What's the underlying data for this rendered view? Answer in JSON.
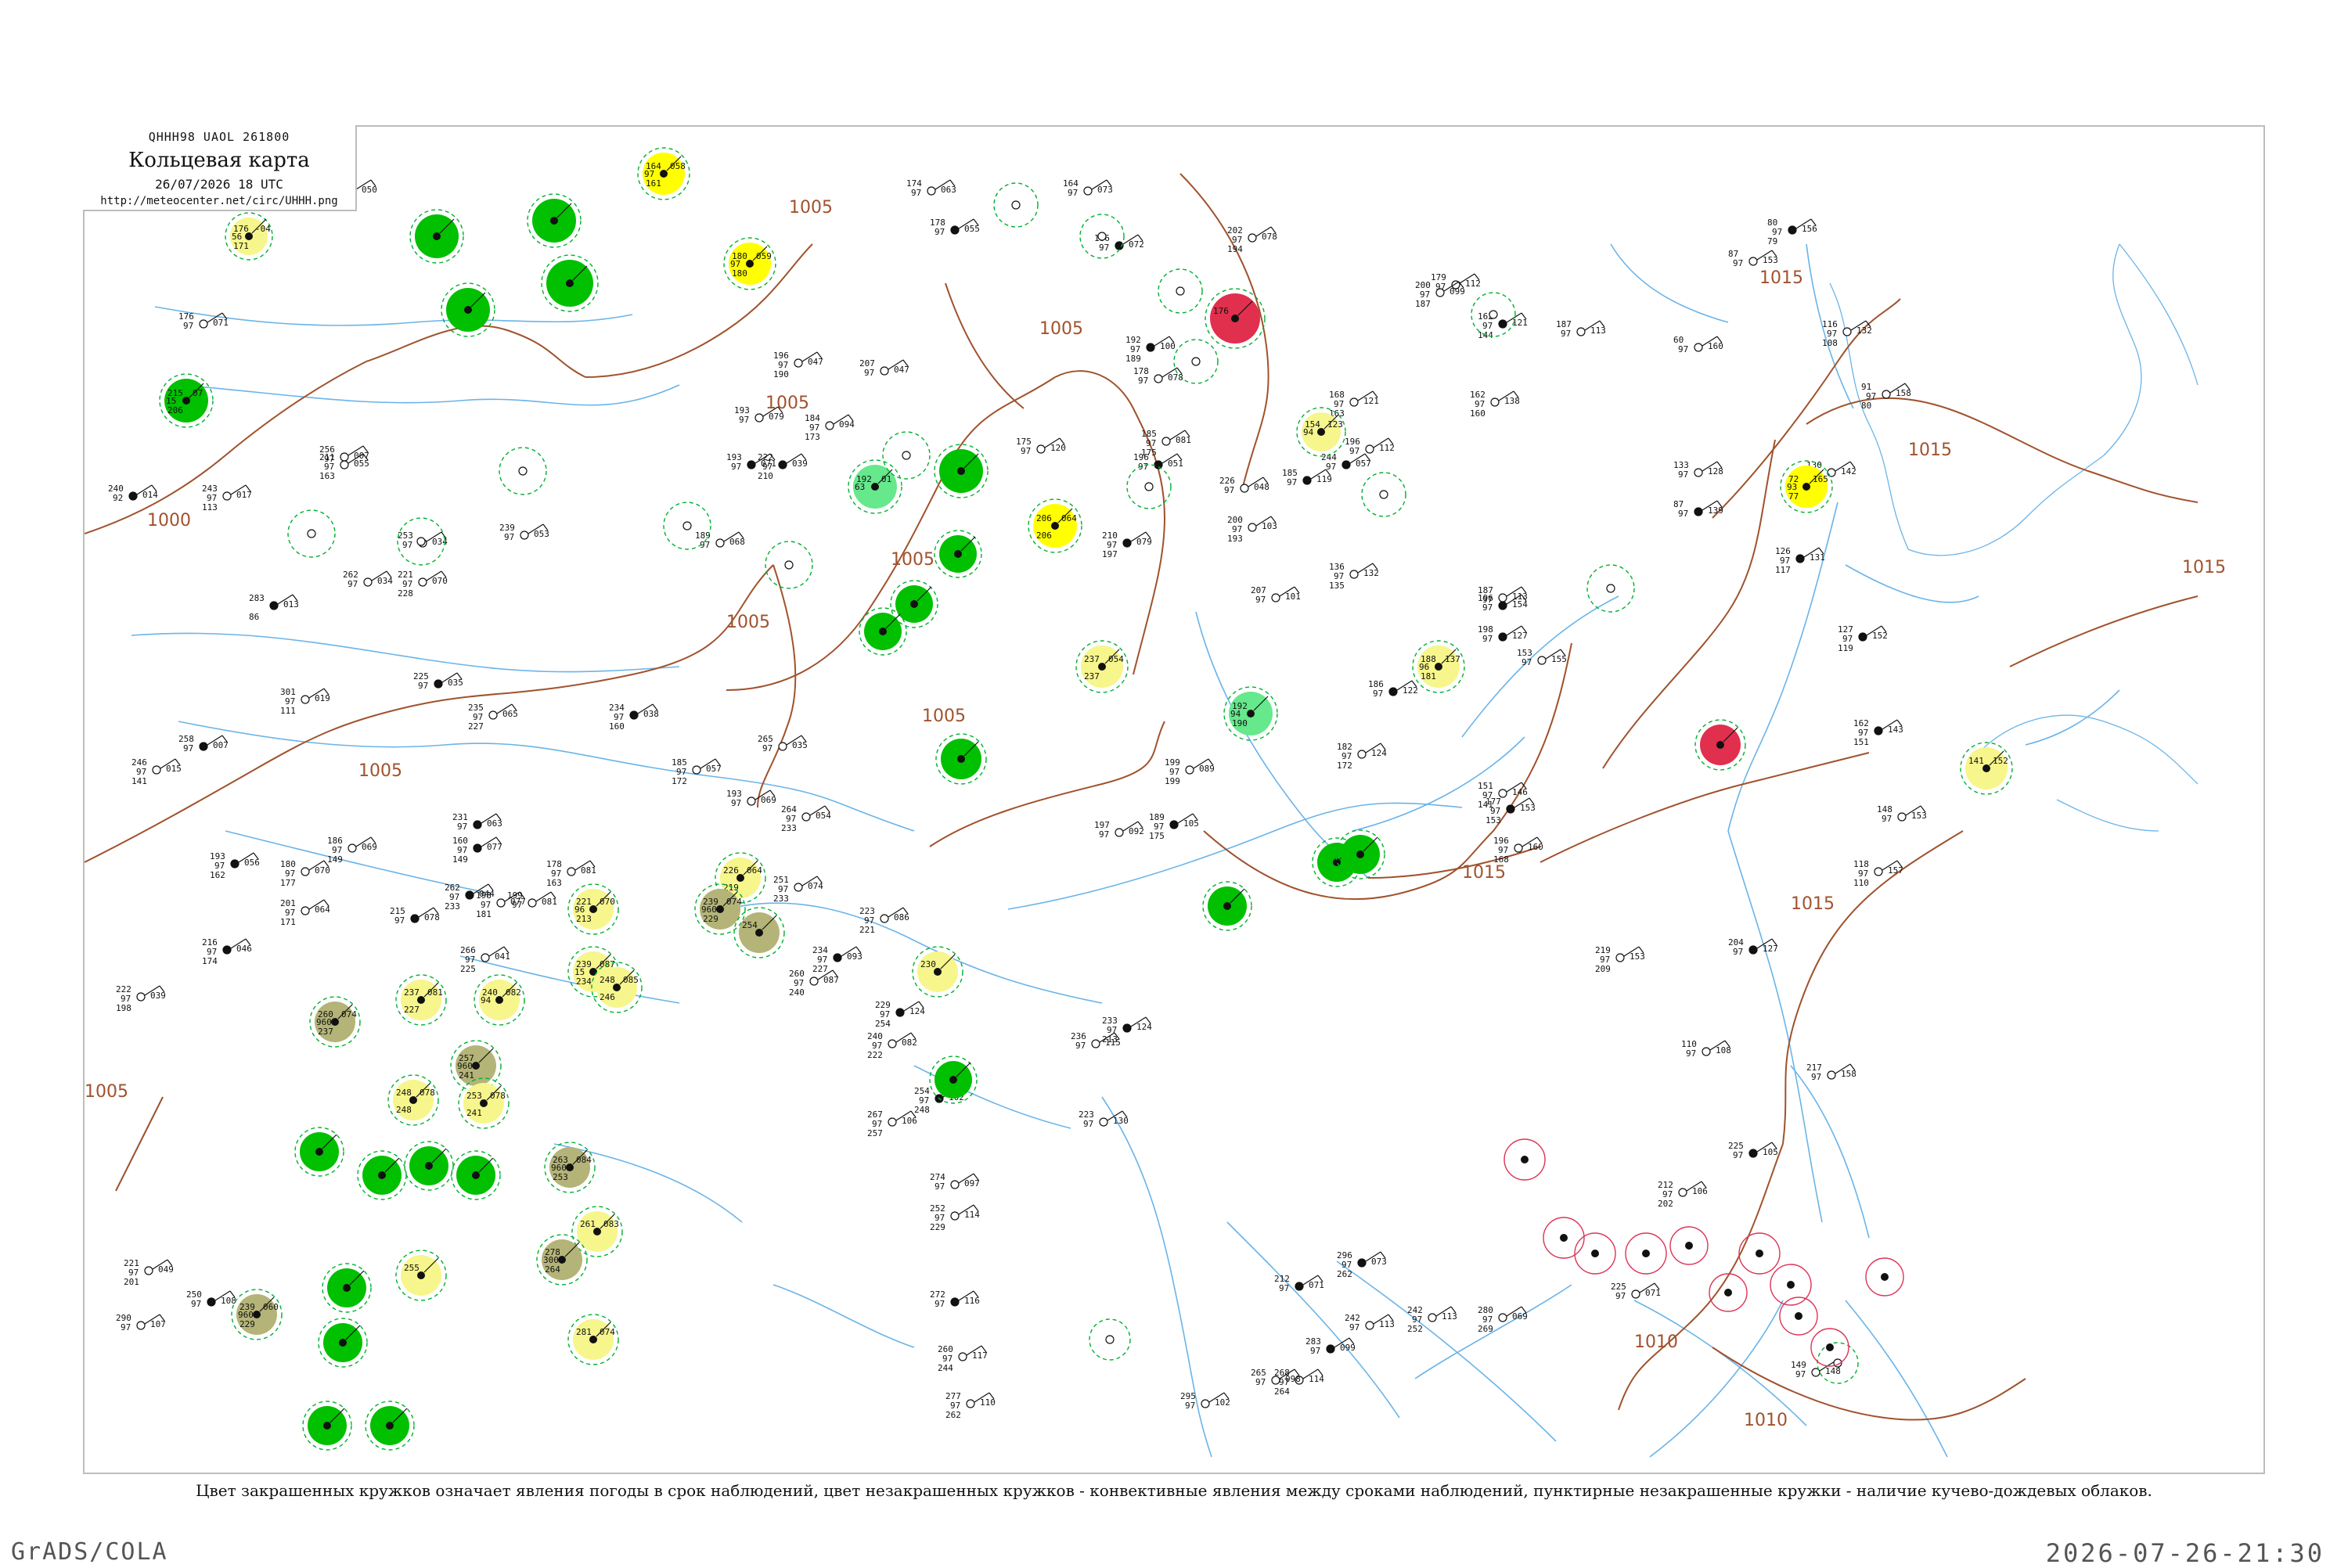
{
  "header": {
    "code_line": "QHHH98  UAOL  261800",
    "title": "Кольцевая карта",
    "datetime": "26/07/2026 18 UTC",
    "url": "http://meteocenter.net/circ/UHHH.png"
  },
  "isobars": {
    "labels": [
      "1000",
      "1005",
      "1010",
      "1015"
    ]
  },
  "legend": {
    "colors": {
      "fair": "#00c000",
      "rain_light": "#66e88c",
      "haze": "#ffff00",
      "haze_light": "#f6f68c",
      "dust": "#b4b478",
      "thunder": "#e0304e",
      "isobar": "#a0522d",
      "rivers": "#6ab4e8",
      "cb_dashed": "#00b030",
      "convective": "#dd3355"
    }
  },
  "stations": [
    {
      "code": "56",
      "temp": "176",
      "dew": "171",
      "pres": "-04",
      "color_key": "haze_light"
    },
    {
      "code": "15",
      "temp": "215",
      "dew": "206",
      "pres": "07",
      "color_key": "fair"
    },
    {
      "code": "97",
      "temp": "164",
      "dew": "161",
      "pres": "058",
      "color_key": "haze"
    },
    {
      "code": "97",
      "temp": "180",
      "dew": "180",
      "pres": "059",
      "color_key": "haze"
    },
    {
      "code": "",
      "temp": "176",
      "dew": "",
      "pres": "",
      "color_key": "thunder"
    },
    {
      "code": "63",
      "temp": "192",
      "dew": "",
      "pres": "01",
      "color_key": "rain_light"
    },
    {
      "code": "",
      "temp": "206",
      "dew": "206",
      "pres": "064",
      "color_key": "haze"
    },
    {
      "code": "",
      "temp": "237",
      "dew": "237",
      "pres": "054",
      "color_key": "haze_light"
    },
    {
      "code": "94",
      "temp": "192",
      "dew": "190",
      "pres": "",
      "color_key": "rain_light"
    },
    {
      "code": "96",
      "temp": "188",
      "dew": "181",
      "pres": "137",
      "color_key": "haze_light"
    },
    {
      "code": "94",
      "temp": "154",
      "dew": "",
      "pres": "123",
      "color_key": "haze_light"
    },
    {
      "code": "93",
      "temp": "72",
      "dew": "77",
      "pres": "165",
      "color_key": "haze"
    },
    {
      "code": "",
      "temp": "141",
      "dew": "",
      "pres": "152",
      "color_key": "haze_light"
    },
    {
      "code": "",
      "temp": "226",
      "dew": "219",
      "pres": "064",
      "color_key": "haze_light"
    },
    {
      "code": "9600",
      "temp": "239",
      "dew": "229",
      "pres": "074",
      "color_key": "dust"
    },
    {
      "code": "",
      "temp": "254",
      "dew": "",
      "pres": "",
      "color_key": "dust"
    },
    {
      "code": "96",
      "temp": "221",
      "dew": "213",
      "pres": "070",
      "color_key": "haze_light"
    },
    {
      "code": "15",
      "temp": "239",
      "dew": "234",
      "pres": "087",
      "color_key": "haze_light"
    },
    {
      "code": "",
      "temp": "237",
      "dew": "227",
      "pres": "081",
      "color_key": "haze_light"
    },
    {
      "code": "94",
      "temp": "240",
      "dew": "",
      "pres": "082",
      "color_key": "haze_light"
    },
    {
      "code": "",
      "temp": "248",
      "dew": "246",
      "pres": "085",
      "color_key": "haze_light"
    },
    {
      "code": "9600",
      "temp": "260",
      "dew": "237",
      "pres": "074",
      "color_key": "dust"
    },
    {
      "code": "9600",
      "temp": "257",
      "dew": "241",
      "pres": "",
      "color_key": "dust"
    },
    {
      "code": "",
      "temp": "248",
      "dew": "248",
      "pres": "078",
      "color_key": "haze_light"
    },
    {
      "code": "",
      "temp": "253",
      "dew": "241",
      "pres": "078",
      "color_key": "haze_light"
    },
    {
      "code": "",
      "temp": "230",
      "dew": "",
      "pres": "",
      "color_key": "haze_light"
    },
    {
      "code": "9600",
      "temp": "263",
      "dew": "253",
      "pres": "084",
      "color_key": "dust"
    },
    {
      "code": "",
      "temp": "261",
      "dew": "",
      "pres": "083",
      "color_key": "haze_light"
    },
    {
      "code": "3000",
      "temp": "278",
      "dew": "264",
      "pres": "",
      "color_key": "dust"
    },
    {
      "code": "",
      "temp": "281",
      "dew": "",
      "pres": "074",
      "color_key": "haze_light"
    },
    {
      "code": "",
      "temp": "255",
      "dew": "",
      "pres": "",
      "color_key": "haze_light"
    },
    {
      "code": "9600",
      "temp": "239",
      "dew": "229",
      "pres": "060",
      "color_key": "dust"
    },
    {
      "code": "",
      "temp": "",
      "dew": "",
      "pres": "",
      "color_key": "fair"
    },
    {
      "code": "",
      "temp": "",
      "dew": "",
      "pres": "",
      "color_key": "fair"
    },
    {
      "code": "",
      "temp": "",
      "dew": "",
      "pres": "",
      "color_key": "fair"
    },
    {
      "code": "",
      "temp": "",
      "dew": "",
      "pres": "",
      "color_key": "fair"
    },
    {
      "code": "",
      "temp": "",
      "dew": "",
      "pres": "",
      "color_key": "fair"
    },
    {
      "code": "",
      "temp": "",
      "dew": "",
      "pres": "",
      "color_key": "fair"
    },
    {
      "code": "",
      "temp": "",
      "dew": "",
      "pres": "",
      "color_key": "fair"
    },
    {
      "code": "",
      "temp": "",
      "dew": "",
      "pres": "",
      "color_key": "fair"
    },
    {
      "code": "",
      "temp": "",
      "dew": "",
      "pres": "",
      "color_key": "fair"
    },
    {
      "code": "",
      "temp": "",
      "dew": "",
      "pres": "",
      "color_key": "fair"
    },
    {
      "code": "",
      "temp": "",
      "dew": "",
      "pres": "",
      "color_key": "fair"
    },
    {
      "code": "",
      "temp": "",
      "dew": "",
      "pres": "",
      "color_key": "fair"
    },
    {
      "code": "",
      "temp": "",
      "dew": "",
      "pres": "",
      "color_key": "fair"
    },
    {
      "code": "",
      "temp": "",
      "dew": "",
      "pres": "",
      "color_key": "fair"
    },
    {
      "code": "",
      "temp": "",
      "dew": "",
      "pres": "",
      "color_key": "fair"
    },
    {
      "code": "",
      "temp": "",
      "dew": "",
      "pres": "",
      "color_key": "fair"
    },
    {
      "code": "",
      "temp": "",
      "dew": "",
      "pres": "",
      "color_key": "fair"
    },
    {
      "code": "",
      "temp": "",
      "dew": "",
      "pres": "",
      "color_key": "fair"
    },
    {
      "code": "",
      "temp": "",
      "dew": "",
      "pres": "",
      "color_key": "fair"
    },
    {
      "code": "",
      "temp": "",
      "dew": "",
      "pres": "",
      "color_key": "fair"
    },
    {
      "code": "",
      "temp": "",
      "dew": "",
      "pres": "",
      "color_key": "fair"
    },
    {
      "code": "",
      "temp": "",
      "dew": "",
      "pres": "",
      "color_key": "thunder"
    }
  ],
  "plain_stations": [
    [
      "192",
      "97",
      "163",
      "050"
    ],
    [
      "168",
      "97",
      "163",
      "052"
    ],
    [
      "176",
      "97",
      "",
      "071"
    ],
    [
      "240",
      "92",
      "",
      "014"
    ],
    [
      "243",
      "97",
      "113",
      "017"
    ],
    [
      "256",
      "97",
      "",
      "007"
    ],
    [
      "283",
      "",
      "86",
      "013"
    ],
    [
      "262",
      "97",
      "",
      "034"
    ],
    [
      "253",
      "97",
      "",
      "034"
    ],
    [
      "225",
      "97",
      "",
      "035"
    ],
    [
      "211",
      "97",
      "163",
      "055"
    ],
    [
      "239",
      "97",
      "",
      "053"
    ],
    [
      "222",
      "97",
      "210",
      "039"
    ],
    [
      "189",
      "97",
      "",
      "068"
    ],
    [
      "265",
      "97",
      "",
      "035"
    ],
    [
      "234",
      "97",
      "160",
      "038"
    ],
    [
      "185",
      "97",
      "172",
      "057"
    ],
    [
      "193",
      "97",
      "",
      "069"
    ],
    [
      "216",
      "97",
      "174",
      "046"
    ],
    [
      "222",
      "97",
      "198",
      "039"
    ],
    [
      "246",
      "97",
      "141",
      "015"
    ],
    [
      "258",
      "97",
      "",
      "007"
    ],
    [
      "301",
      "97",
      "111",
      "019"
    ],
    [
      "186",
      "97",
      "149",
      "069"
    ],
    [
      "193",
      "97",
      "162",
      "056"
    ],
    [
      "180",
      "97",
      "177",
      "070"
    ],
    [
      "201",
      "97",
      "171",
      "064"
    ],
    [
      "215",
      "97",
      "",
      "078"
    ],
    [
      "178",
      "97",
      "163",
      "081"
    ],
    [
      "198",
      "97",
      "181",
      "077"
    ],
    [
      "160",
      "97",
      "149",
      "077"
    ],
    [
      "264",
      "97",
      "233",
      "054"
    ],
    [
      "251",
      "97",
      "233",
      "074"
    ],
    [
      "234",
      "97",
      "227",
      "093"
    ],
    [
      "223",
      "97",
      "221",
      "086"
    ],
    [
      "260",
      "97",
      "240",
      "087"
    ],
    [
      "229",
      "97",
      "254",
      "124"
    ],
    [
      "240",
      "97",
      "222",
      "082"
    ],
    [
      "267",
      "97",
      "257",
      "106"
    ],
    [
      "254",
      "97",
      "248",
      "102"
    ],
    [
      "274",
      "97",
      "",
      "097"
    ],
    [
      "252",
      "97",
      "229",
      "114"
    ],
    [
      "272",
      "97",
      "",
      "116"
    ],
    [
      "260",
      "97",
      "244",
      "117"
    ],
    [
      "277",
      "97",
      "262",
      "110"
    ],
    [
      "233",
      "97",
      "213",
      "124"
    ],
    [
      "223",
      "97",
      "",
      "130"
    ],
    [
      "236",
      "97",
      "",
      "115"
    ],
    [
      "210",
      "97",
      "197",
      "079"
    ],
    [
      "199",
      "97",
      "199",
      "089"
    ],
    [
      "197",
      "97",
      "",
      "092"
    ],
    [
      "189",
      "97",
      "175",
      "105"
    ],
    [
      "200",
      "97",
      "193",
      "103"
    ],
    [
      "182",
      "97",
      "172",
      "124"
    ],
    [
      "186",
      "97",
      "",
      "122"
    ],
    [
      "196",
      "97",
      "",
      "112"
    ],
    [
      "207",
      "97",
      "",
      "101"
    ],
    [
      "185",
      "97",
      "",
      "119"
    ],
    [
      "168",
      "97",
      "163",
      "121"
    ],
    [
      "179",
      "97",
      "",
      "112"
    ],
    [
      "162",
      "97",
      "144",
      "121"
    ],
    [
      "162",
      "97",
      "160",
      "138"
    ],
    [
      "187",
      "97",
      "",
      "113"
    ],
    [
      "198",
      "97",
      "",
      "127"
    ],
    [
      "153",
      "97",
      "",
      "155"
    ],
    [
      "151",
      "97",
      "141",
      "146"
    ],
    [
      "177",
      "97",
      "153",
      "153"
    ],
    [
      "196",
      "97",
      "168",
      "160"
    ],
    [
      "219",
      "97",
      "209",
      "153"
    ],
    [
      "204",
      "97",
      "",
      "127"
    ],
    [
      "110",
      "97",
      "",
      "108"
    ],
    [
      "217",
      "97",
      "",
      "158"
    ],
    [
      "225",
      "97",
      "",
      "105"
    ],
    [
      "212",
      "97",
      "202",
      "106"
    ],
    [
      "149",
      "97",
      "",
      "148"
    ],
    [
      "162",
      "97",
      "151",
      "143"
    ],
    [
      "148",
      "97",
      "",
      "153"
    ],
    [
      "118",
      "97",
      "110",
      "157"
    ],
    [
      "127",
      "97",
      "119",
      "152"
    ],
    [
      "91",
      "97",
      "80",
      "158"
    ],
    [
      "130",
      "97",
      "",
      "142"
    ],
    [
      "126",
      "97",
      "117",
      "131"
    ],
    [
      "87",
      "97",
      "",
      "153"
    ],
    [
      "60",
      "97",
      "",
      "160"
    ],
    [
      "80",
      "97",
      "79",
      "156"
    ],
    [
      "116",
      "97",
      "108",
      "132"
    ],
    [
      "133",
      "97",
      "",
      "128"
    ],
    [
      "87",
      "97",
      "",
      "139"
    ],
    [
      "136",
      "97",
      "135",
      "132"
    ],
    [
      "187",
      "97",
      "",
      "113"
    ],
    [
      "196",
      "97",
      "",
      "154"
    ],
    [
      "200",
      "97",
      "187",
      "099"
    ],
    [
      "202",
      "97",
      "194",
      "078"
    ],
    [
      "186",
      "97",
      "",
      "072"
    ],
    [
      "164",
      "97",
      "",
      "073"
    ],
    [
      "174",
      "97",
      "",
      "063"
    ],
    [
      "178",
      "97",
      "",
      "055"
    ],
    [
      "207",
      "97",
      "",
      "047"
    ],
    [
      "196",
      "97",
      "190",
      "047"
    ],
    [
      "193",
      "97",
      "",
      "071"
    ],
    [
      "193",
      "97",
      "",
      "079"
    ],
    [
      "184",
      "97",
      "173",
      "094"
    ],
    [
      "192",
      "97",
      "189",
      "100"
    ],
    [
      "178",
      "97",
      "",
      "078"
    ],
    [
      "185",
      "97",
      "175",
      "081"
    ],
    [
      "196",
      "97",
      "",
      "051"
    ],
    [
      "175",
      "97",
      "",
      "120"
    ],
    [
      "226",
      "97",
      "",
      "048"
    ],
    [
      "244",
      "97",
      "",
      "057"
    ],
    [
      "221",
      "97",
      "228",
      "070"
    ],
    [
      "235",
      "97",
      "227",
      "065"
    ],
    [
      "231",
      "97",
      "",
      "063"
    ],
    [
      "199",
      "97",
      "",
      "081"
    ],
    [
      "266",
      "97",
      "225",
      "041"
    ],
    [
      "262",
      "97",
      "233",
      "044"
    ],
    [
      "221",
      "97",
      "201",
      "049"
    ],
    [
      "290",
      "97",
      "",
      "107"
    ],
    [
      "250",
      "97",
      "",
      "108"
    ],
    [
      "295",
      "97",
      "",
      "102"
    ],
    [
      "268",
      "97",
      "264",
      "114"
    ],
    [
      "283",
      "97",
      "",
      "099"
    ],
    [
      "265",
      "97",
      "",
      "098"
    ],
    [
      "242",
      "97",
      "",
      "113"
    ],
    [
      "212",
      "97",
      "",
      "071"
    ],
    [
      "242",
      "97",
      "252",
      "113"
    ],
    [
      "280",
      "97",
      "269",
      "069"
    ],
    [
      "296",
      "97",
      "262",
      "073"
    ],
    [
      "225",
      "97",
      "",
      "071"
    ]
  ],
  "caption": "Цвет закрашенных кружков означает явления погоды в срок наблюдений, цвет незакрашенных кружков - конвективные явления между сроками наблюдений, пунктирные незакрашенные кружки - наличие кучево-дождевых облаков.",
  "footer": {
    "left": "GrADS/COLA",
    "right": "2026-07-26-21:30"
  }
}
